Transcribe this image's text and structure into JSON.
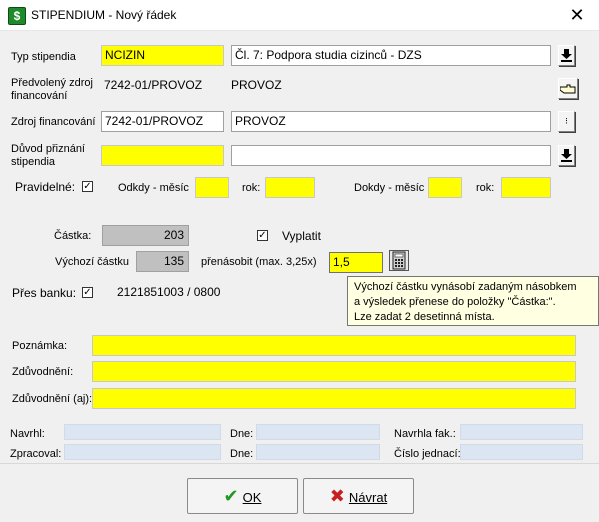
{
  "window": {
    "title": "STIPENDIUM - Nový řádek"
  },
  "typ": {
    "label": "Typ stipendia",
    "code": "NCIZIN",
    "desc": "Čl. 7: Podpora studia cizinců - DZS"
  },
  "predvoleny": {
    "label_line1": "Předvolený zdroj",
    "label_line2": "financování",
    "code": "7242-01/PROVOZ",
    "desc": "PROVOZ"
  },
  "zdroj": {
    "label": "Zdroj financování",
    "code": "7242-01/PROVOZ",
    "desc": "PROVOZ"
  },
  "duvod": {
    "label_line1": "Důvod přiznání",
    "label_line2": "stipendia",
    "code": "",
    "desc": ""
  },
  "pravidelne": {
    "label": "Pravidelné:",
    "checked": true,
    "odkdy_label": "Odkdy - měsíc",
    "rok_label": "rok:",
    "dokdy_label": "Dokdy - měsíc",
    "rok2_label": "rok:",
    "odkdy": "",
    "odkdy_rok": "",
    "dokdy": "",
    "dokdy_rok": ""
  },
  "castka": {
    "label": "Částka:",
    "value": "203",
    "vyplatit_label": "Vyplatit",
    "vyplatit_checked": true
  },
  "vychozi": {
    "label": "Výchozí částku",
    "value": "135",
    "prenasobit_label": "přenásobit (max. 3,25x)",
    "multiplier": "1,5"
  },
  "tooltip": {
    "line1": "Výchozí částku vynásobí zadaným násobkem",
    "line2": "a výsledek přenese do položky \"Částka:\".",
    "line3": "Lze zadat 2 desetinná místa."
  },
  "banka": {
    "label": "Přes banku:",
    "checked": true,
    "account": "2121851003 / 0800"
  },
  "poznamka": {
    "label": "Poznámka:",
    "value": ""
  },
  "zduvodneni": {
    "label": "Zdůvodnění:",
    "value": ""
  },
  "zduvodneni_aj": {
    "label": "Zdůvodnění (aj):",
    "value": ""
  },
  "footer": {
    "navrhl_label": "Navrhl:",
    "dne1_label": "Dne:",
    "navrhla_fak_label": "Navrhla fak.:",
    "zpracoval_label": "Zpracoval:",
    "dne2_label": "Dne:",
    "cislo_jednaci_label": "Číslo jednací:"
  },
  "buttons": {
    "ok": "OK",
    "navrat": "Návrat"
  },
  "icons": {
    "dropdown": "download-arrow-icon",
    "copy": "hand-pointer-icon",
    "calculator": "calculator-icon"
  }
}
